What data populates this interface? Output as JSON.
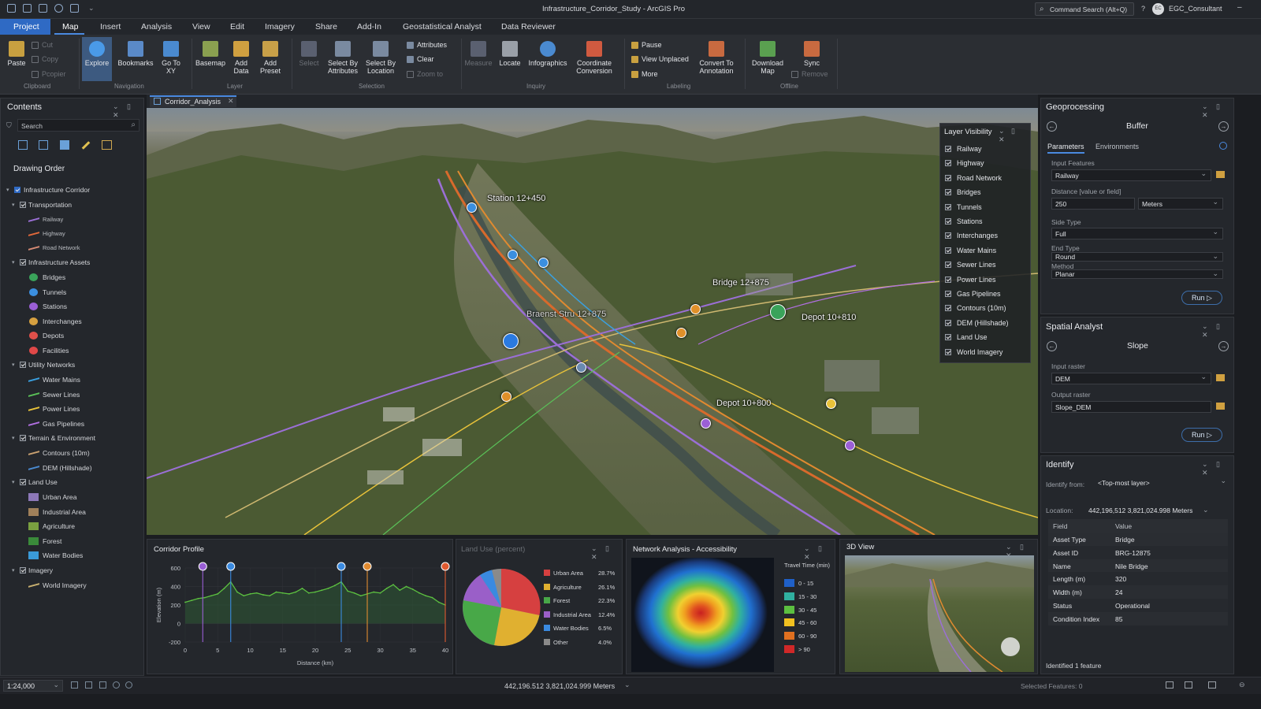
{
  "app": {
    "title": "Infrastructure_Corridor_Study - ArcGIS Pro",
    "search": "Command Search (Alt+Q)",
    "help": "?",
    "user_initials": "EC",
    "user": "EGC_Consultant"
  },
  "tabs": [
    "Project",
    "Map",
    "Insert",
    "Analysis",
    "View",
    "Edit",
    "Imagery",
    "Share",
    "Add-In",
    "Geostatistical Analyst",
    "Data Reviewer"
  ],
  "ribbon": {
    "clipboard": {
      "paste": "Paste",
      "cut": "Cut",
      "copy": "Copy",
      "copy_path": "Pcopier",
      "group": "Clipboard"
    },
    "navigation": {
      "explore": "Explore",
      "bookmarks": "Bookmarks",
      "goto": "Go To XY",
      "group": "Navigation"
    },
    "layer": {
      "basemap": "Basemap",
      "add_data": "Add Data",
      "add_preset": "Add Preset",
      "group": "Layer"
    },
    "selection": {
      "select": "Select",
      "by_attr": "Select By Attributes",
      "by_loc": "Select By Location",
      "attributes": "Attributes",
      "clear": "Clear",
      "zoom": "Zoom to",
      "group": "Selection"
    },
    "inquiry": {
      "measure": "Measure",
      "locate": "Locate",
      "infographics": "Infographics",
      "coord": "Coordinate Conversion",
      "group": "Inquiry"
    },
    "labeling": {
      "pause": "Pause",
      "view_unplaced": "View Unplaced",
      "more": "More",
      "convert": "Convert To Annotation",
      "group": "Labeling"
    },
    "offline": {
      "download": "Download Map",
      "sync": "Sync",
      "remove": "Remove",
      "group": "Offline"
    }
  },
  "contents": {
    "title": "Contents",
    "search_placeholder": "Search",
    "drawing_order": "Drawing Order",
    "root": "Infrastructure Corridor",
    "groups": [
      {
        "name": "Transportation",
        "items": [
          {
            "label": "Railway",
            "color": "#9b6fd6"
          },
          {
            "label": "Highway",
            "color": "#e0683a"
          },
          {
            "label": "Road Network",
            "color": "#d58a74"
          }
        ]
      },
      {
        "name": "Infrastructure Assets",
        "items": [
          {
            "label": "Bridges",
            "color": "#3aa35a"
          },
          {
            "label": "Tunnels",
            "color": "#3b8fe0"
          },
          {
            "label": "Stations",
            "color": "#9b5fd6"
          },
          {
            "label": "Interchanges",
            "color": "#d6a040"
          },
          {
            "label": "Depots",
            "color": "#e0504a"
          },
          {
            "label": "Facilities",
            "color": "#e04848"
          }
        ]
      },
      {
        "name": "Utility Networks",
        "items": [
          {
            "label": "Water Mains",
            "color": "#3aa0e0"
          },
          {
            "label": "Sewer Lines",
            "color": "#5ac058"
          },
          {
            "label": "Power Lines",
            "color": "#e8c23a"
          },
          {
            "label": "Gas Pipelines",
            "color": "#b06fe0"
          }
        ]
      },
      {
        "name": "Terrain & Environment",
        "items": [
          {
            "label": "Contours (10m)",
            "color": "#c8a070"
          },
          {
            "label": "DEM (Hillshade)",
            "color": "#4a8ad0"
          }
        ]
      },
      {
        "name": "Land Use",
        "items": [
          {
            "label": "Urban Area",
            "color": "#8d78b8"
          },
          {
            "label": "Industrial Area",
            "color": "#a0805a"
          },
          {
            "label": "Agriculture",
            "color": "#7aa040"
          },
          {
            "label": "Forest",
            "color": "#3a8a3a"
          },
          {
            "label": "Water Bodies",
            "color": "#3a9ad8"
          }
        ]
      },
      {
        "name": "Imagery",
        "items": [
          {
            "label": "World Imagery",
            "color": "#c8b070"
          }
        ]
      }
    ]
  },
  "map": {
    "tab": "Corridor_Analysis",
    "labels": {
      "station": "Station 12+450",
      "bridge": "Bridge 12+875",
      "depot1": "Depot 10+810",
      "depot2": "Depot 10+800",
      "garbled": "Braenst Stru 12+875"
    },
    "layer_visibility": {
      "title": "Layer Visibility",
      "items": [
        "Railway",
        "Highway",
        "Road Network",
        "Bridges",
        "Tunnels",
        "Stations",
        "Interchanges",
        "Water Mains",
        "Sewer Lines",
        "Power Lines",
        "Gas Pipelines",
        "Contours (10m)",
        "DEM (Hillshade)",
        "Land Use",
        "World Imagery"
      ]
    }
  },
  "geoprocessing": {
    "title": "Geoprocessing",
    "tool": "Buffer",
    "tab_params": "Parameters",
    "tab_env": "Environments",
    "input_label": "Input Features",
    "input_value": "Railway",
    "distance_label": "Distance [value or field]",
    "distance_value": "250",
    "distance_unit": "Meters",
    "side_label": "Side Type",
    "side_value": "Full",
    "end_label": "End Type",
    "end_value": "Round",
    "method_label": "Method",
    "method_value": "Planar",
    "run": "Run"
  },
  "spatial": {
    "title": "Spatial Analyst",
    "tool": "Slope",
    "input_label": "Input raster",
    "input_value": "DEM",
    "output_label": "Output raster",
    "output_value": "Slope_DEM",
    "run": "Run"
  },
  "identify": {
    "title": "Identify",
    "from_label": "Identify from:",
    "from_value": "<Top-most layer>",
    "location_label": "Location:",
    "location_value": "442,196,512  3,821,024.998 Meters",
    "col_field": "Field",
    "col_value": "Value",
    "rows": [
      {
        "field": "Asset Type",
        "value": "Bridge"
      },
      {
        "field": "Asset ID",
        "value": "BRG-12875"
      },
      {
        "field": "Name",
        "value": "Nile Bridge"
      },
      {
        "field": "Length (m)",
        "value": "320"
      },
      {
        "field": "Width (m)",
        "value": "24"
      },
      {
        "field": "Status",
        "value": "Operational"
      },
      {
        "field": "Condition Index",
        "value": "85"
      }
    ],
    "footer": "Identified 1 feature"
  },
  "profile": {
    "title": "Corridor Profile",
    "ylabel": "Elevation (m)",
    "xlabel": "Distance (km)",
    "ytick_labels": [
      "600",
      "400",
      "200",
      "0",
      "-200"
    ],
    "xtick_labels": [
      "0",
      "5",
      "10",
      "15",
      "20",
      "25",
      "30",
      "35",
      "40"
    ]
  },
  "landuse": {
    "title": "Land Use (percent)",
    "rows": [
      {
        "label": "Urban Area",
        "value": "28.7%",
        "color": "#d64040"
      },
      {
        "label": "Agriculture",
        "value": "26.1%",
        "color": "#e0b030"
      },
      {
        "label": "Forest",
        "value": "22.3%",
        "color": "#48a848"
      },
      {
        "label": "Industrial Area",
        "value": "12.4%",
        "color": "#9a5fc8"
      },
      {
        "label": "Water Bodies",
        "value": "6.5%",
        "color": "#3a8ae0"
      },
      {
        "label": "Other",
        "value": "4.0%",
        "color": "#8a8a8a"
      }
    ]
  },
  "network": {
    "title": "Network Analysis - Accessibility",
    "legend_title": "Travel Time (min)",
    "legend": [
      {
        "label": "0 - 15",
        "color": "#1f60c8"
      },
      {
        "label": "15 - 30",
        "color": "#30b0a0"
      },
      {
        "label": "30 - 45",
        "color": "#5cc040"
      },
      {
        "label": "45 - 60",
        "color": "#f0c020"
      },
      {
        "label": "60 - 90",
        "color": "#e07020"
      },
      {
        "label": "> 90",
        "color": "#d02828"
      }
    ]
  },
  "view3d": {
    "title": "3D View"
  },
  "status": {
    "scale": "1:24,000",
    "coords": "442,196.512  3,821,024.999 Meters",
    "selected": "Selected Features: 0"
  },
  "chart_data": {
    "type": "line",
    "title": "Corridor Profile",
    "xlabel": "Distance (km)",
    "ylabel": "Elevation (m)",
    "xlim": [
      0,
      40
    ],
    "ylim": [
      -200,
      600
    ],
    "x": [
      0,
      1,
      2,
      3,
      4,
      5,
      6,
      7,
      8,
      9,
      10,
      11,
      12,
      13,
      14,
      15,
      16,
      17,
      18,
      19,
      20,
      21,
      22,
      23,
      24,
      25,
      26,
      27,
      28,
      29,
      30,
      31,
      32,
      33,
      34,
      35,
      36,
      37,
      38,
      39,
      40
    ],
    "y": [
      230,
      250,
      270,
      280,
      300,
      320,
      380,
      450,
      340,
      300,
      320,
      330,
      310,
      300,
      340,
      330,
      320,
      340,
      380,
      330,
      340,
      360,
      380,
      410,
      450,
      350,
      330,
      300,
      320,
      340,
      330,
      380,
      420,
      360,
      400,
      370,
      330,
      300,
      280,
      230,
      200
    ],
    "markers": [
      {
        "x": 2.7,
        "color": "#9a5fd6"
      },
      {
        "x": 7.0,
        "color": "#3a8ae0"
      },
      {
        "x": 24.0,
        "color": "#3a8ae0"
      },
      {
        "x": 28.0,
        "color": "#e08a30"
      },
      {
        "x": 40.0,
        "color": "#e05a30"
      }
    ]
  }
}
